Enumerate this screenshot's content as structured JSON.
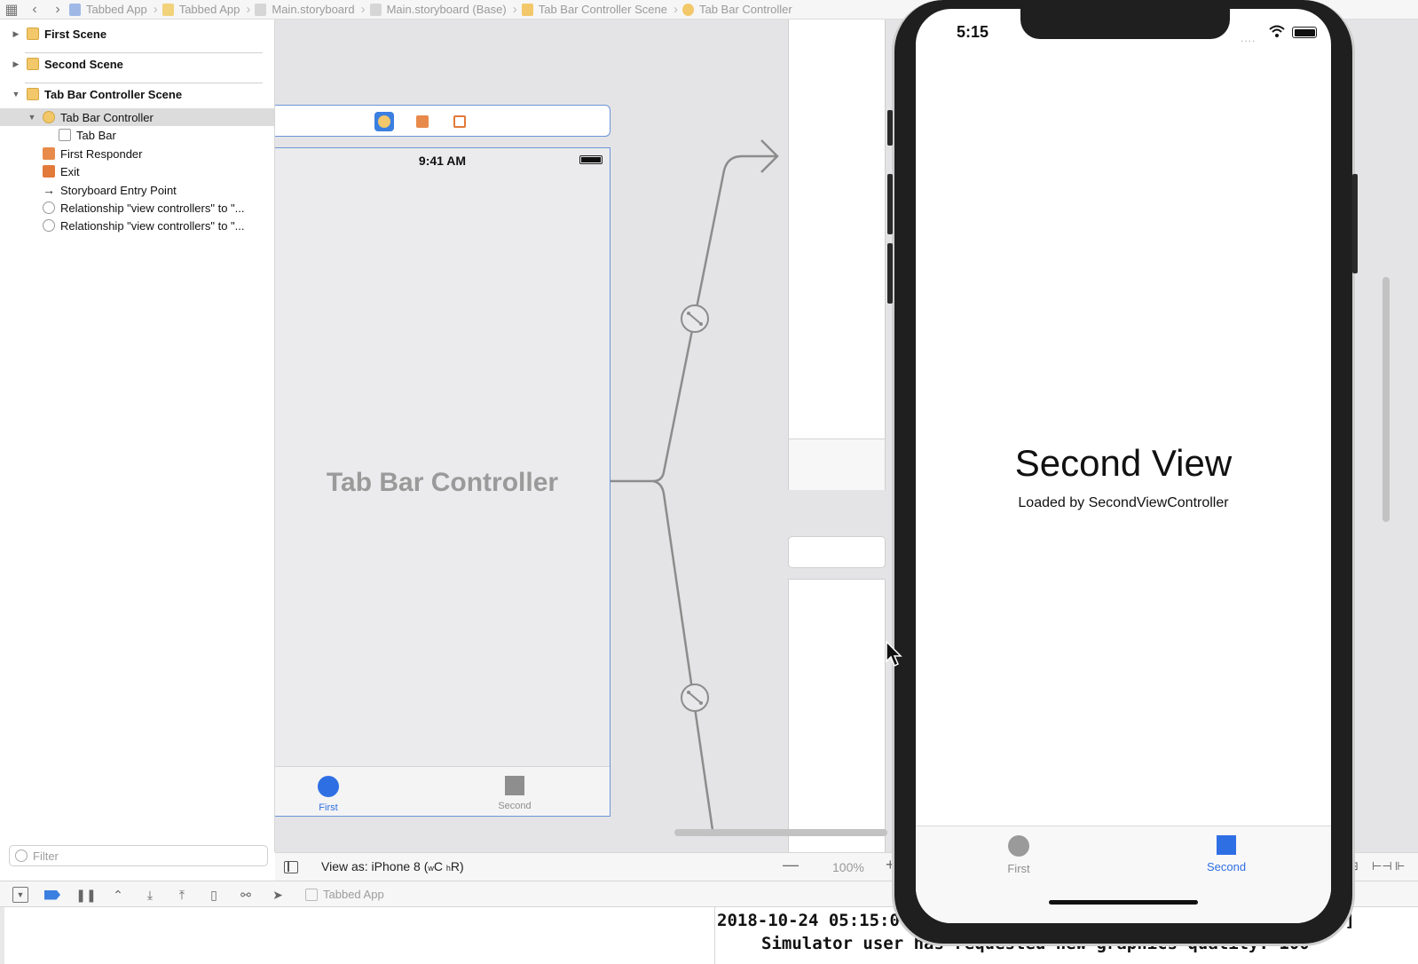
{
  "jumpbar": {
    "crumbs": [
      {
        "label": "Tabbed App",
        "icon": "project-file-icon",
        "color": "#9fb9e6"
      },
      {
        "label": "Tabbed App",
        "icon": "folder-icon",
        "color": "#f2d27a"
      },
      {
        "label": "Main.storyboard",
        "icon": "storyboard-file-icon",
        "color": "#c8c8c8"
      },
      {
        "label": "Main.storyboard (Base)",
        "icon": "storyboard-file-icon",
        "color": "#c8c8c8"
      },
      {
        "label": "Tab Bar Controller Scene",
        "icon": "scene-icon",
        "color": "#f2c86a"
      },
      {
        "label": "Tab Bar Controller",
        "icon": "tab-bar-controller-icon",
        "color": "#f2c86a"
      }
    ]
  },
  "outline": {
    "scenes": [
      {
        "label": "First Scene",
        "expanded": false
      },
      {
        "label": "Second Scene",
        "expanded": false
      },
      {
        "label": "Tab Bar Controller Scene",
        "expanded": true
      }
    ],
    "items": [
      {
        "label": "Tab Bar Controller",
        "selected": true
      },
      {
        "label": "Tab Bar"
      },
      {
        "label": "First Responder"
      },
      {
        "label": "Exit"
      },
      {
        "label": "Storyboard Entry Point"
      },
      {
        "label": "Relationship \"view controllers\" to \"..."
      },
      {
        "label": "Relationship \"view controllers\" to \"..."
      }
    ],
    "filter_placeholder": "Filter"
  },
  "canvas": {
    "vc_status_time": "9:41 AM",
    "vc_title": "Tab Bar Controller",
    "vc_tabs": [
      {
        "label": "First",
        "icon": "circle-tab-icon",
        "active": true
      },
      {
        "label": "Second",
        "icon": "square-tab-icon",
        "active": false
      }
    ]
  },
  "canvas_bar": {
    "view_as_prefix": "View as: iPhone 8 (",
    "size_w": "w",
    "size_w_val": "C",
    "size_h": "h",
    "size_h_val": "R",
    "view_as_suffix": ")",
    "zoom_minus": "—",
    "zoom_level": "100%",
    "zoom_plus": "+"
  },
  "debug_bar": {
    "target": "Tabbed App"
  },
  "console": {
    "line1": "2018-10-24 05:15:0",
    "line1_tail": "5]",
    "line2": "Simulator user has requested new graphics quality: 100"
  },
  "simulator": {
    "time": "5:15",
    "signal": "....",
    "title": "Second View",
    "subtitle": "Loaded by SecondViewController",
    "tabs": [
      {
        "label": "First",
        "icon": "circle-tab-icon",
        "active": false
      },
      {
        "label": "Second",
        "icon": "square-tab-icon",
        "active": true
      }
    ]
  },
  "colors": {
    "accent_blue": "#2f6fe4",
    "inactive_gray": "#8e8e8e",
    "selection_border": "#6b95d8",
    "segue_line": "#8c8c8c"
  }
}
